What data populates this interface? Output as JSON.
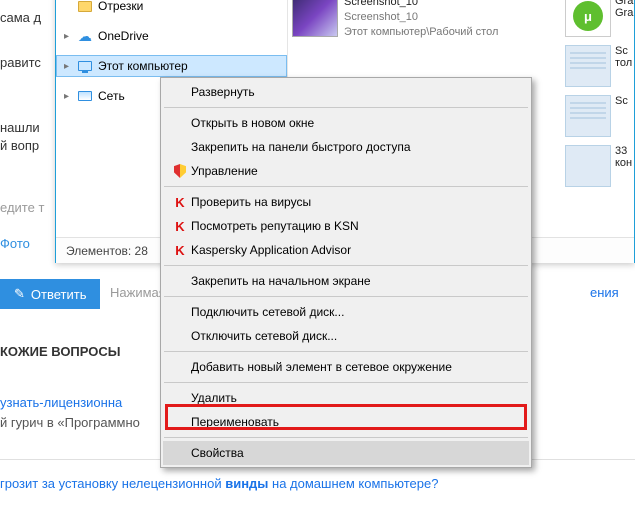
{
  "bg": {
    "sama": "сама д",
    "ravitsya": "равитс",
    "nashli": "нашли",
    "vopr": "й вопр",
    "edite": "едите т",
    "foto": "Фото",
    "nazhimaya": "Нажимая",
    "eniya": "ения",
    "similar_heading": "КОЖИЕ ВОПРОСЫ",
    "link1": "узнать-лицензионна",
    "link1_sub": "й гурич в «Программно",
    "q2_a": "грозит за установку нелецензионной ",
    "q2_b": "винды",
    "q2_c": " на домашнем компьютере?"
  },
  "reply": {
    "label": "Ответить"
  },
  "tree": {
    "otrezki": "Отрезки",
    "onedrive": "OneDrive",
    "thispc": "Этот компьютер",
    "network": "Сеть"
  },
  "files": {
    "f1_name": "Screenshot_10",
    "f1_sub": "Screenshot_10",
    "f1_path": "Этот компьютер\\Рабочий стол",
    "r1": "Gra",
    "r1b": "Gra",
    "r2": "Sc",
    "r2b": "тол",
    "r3": "Sc",
    "r4": "33",
    "r4b": "кон"
  },
  "status": {
    "count": "Элементов: 28"
  },
  "ctx": {
    "expand": "Развернуть",
    "open_new": "Открыть в новом окне",
    "pin_quick": "Закрепить на панели быстрого доступа",
    "manage": "Управление",
    "scan": "Проверить на вирусы",
    "ksn": "Посмотреть репутацию в KSN",
    "kaa": "Kaspersky Application Advisor",
    "pin_start": "Закрепить на начальном экране",
    "map_drive": "Подключить сетевой диск...",
    "unmap_drive": "Отключить сетевой диск...",
    "add_netloc": "Добавить новый элемент в сетевое окружение",
    "delete": "Удалить",
    "rename": "Переименовать",
    "properties": "Свойства"
  }
}
